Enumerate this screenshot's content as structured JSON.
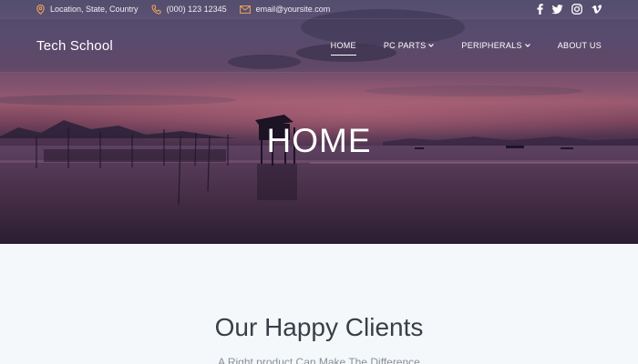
{
  "topbar": {
    "location": "Location, State, Country",
    "phone": "(000) 123 12345",
    "email": "email@yoursite.com",
    "icons": {
      "location": "map-pin-icon",
      "phone": "phone-icon",
      "email": "envelope-icon"
    },
    "socials": [
      {
        "name": "facebook-icon",
        "glyph": "f"
      },
      {
        "name": "twitter-icon",
        "glyph": "t"
      },
      {
        "name": "instagram-icon",
        "glyph": "ig"
      },
      {
        "name": "vimeo-icon",
        "glyph": "v"
      }
    ],
    "accent_color": "#f0a35a"
  },
  "nav": {
    "brand": "Tech School",
    "items": [
      {
        "label": "HOME",
        "active": true
      },
      {
        "label": "PC PARTS",
        "dropdown": true
      },
      {
        "label": "PERIPHERALS",
        "dropdown": true
      },
      {
        "label": "ABOUT US"
      }
    ]
  },
  "hero": {
    "title": "HOME"
  },
  "section": {
    "title": "Our Happy Clients",
    "subtitle": "A Right product Can Make The Difference"
  }
}
